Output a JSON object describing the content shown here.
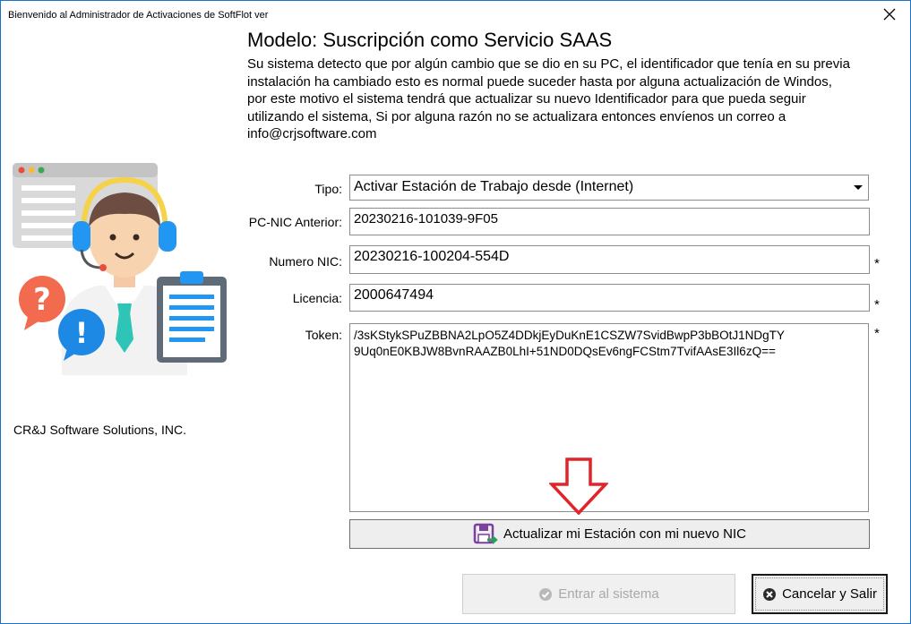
{
  "window": {
    "title": "Bienvenido al Administrador de Activaciones de SoftFlot ver"
  },
  "header": {
    "title": "Modelo: Suscripción como Servicio SAAS",
    "description_lines": [
      "Su sistema detecto que por algún cambio que se dio en su PC, el identificador que tenía en su previa",
      "instalación ha cambiado esto es normal puede suceder hasta por alguna actualización de Windos,",
      "por este motivo el sistema tendrá que actualizar su nuevo Identificador para que pueda seguir",
      "utilizando el sistema, Si por alguna razón no se actualizara entonces envíenos un correo a",
      "info@crjsoftware.com"
    ]
  },
  "company": "CR&J Software Solutions, INC.",
  "form": {
    "tipo_label": "Tipo:",
    "tipo_value": "Activar Estación de Trabajo desde (Internet)",
    "pcnic_label": "PC-NIC Anterior:",
    "pcnic_value": "20230216-101039-9F05",
    "numeronic_label": "Numero NIC:",
    "numeronic_value": "20230216-100204-554D",
    "licencia_label": "Licencia:",
    "licencia_value": "2000647494",
    "token_label": "Token:",
    "token_lines": [
      "/3sKStykSPuZBBNA2LpO5Z4DDkjEyDuKnE1CSZW7SvidBwpP3bBOtJ1NDgTY",
      "9Uq0nE0KBJW8BvnRAAZB0LhI+51ND0DQsEv6ngFCStm7TvifAAsE3Il6zQ=="
    ],
    "required_mark": "*"
  },
  "buttons": {
    "update": "Actualizar mi Estación con mi nuevo NIC",
    "enter": "Entrar al sistema",
    "exit": "Cancelar y Salir"
  },
  "icons": {
    "update_icon": "save-arrow-icon",
    "enter_icon": "check-circle-icon",
    "exit_icon": "close-circle-icon",
    "close": "close-icon"
  },
  "colors": {
    "border": "#1a73c8",
    "arrow_red": "#e0242a",
    "disabled_text": "#a9a9a9"
  }
}
